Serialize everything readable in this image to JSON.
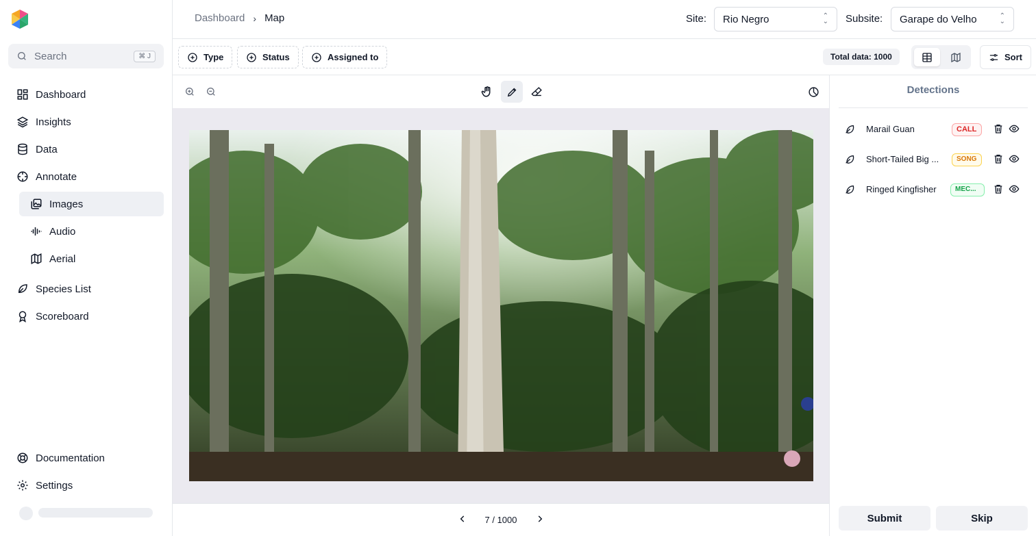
{
  "sidebar": {
    "search": {
      "placeholder": "Search",
      "shortcut": "⌘ J"
    },
    "items": [
      {
        "label": "Dashboard",
        "icon": "dashboard-icon"
      },
      {
        "label": "Insights",
        "icon": "layers-icon"
      },
      {
        "label": "Data",
        "icon": "database-icon"
      },
      {
        "label": "Annotate",
        "icon": "crosshair-icon"
      },
      {
        "label": "Images",
        "icon": "images-icon",
        "active": true
      },
      {
        "label": "Audio",
        "icon": "audio-waveform-icon"
      },
      {
        "label": "Aerial",
        "icon": "map-icon"
      },
      {
        "label": "Species List",
        "icon": "leaf-icon"
      },
      {
        "label": "Scoreboard",
        "icon": "award-icon"
      },
      {
        "label": "Documentation",
        "icon": "lifebuoy-icon"
      },
      {
        "label": "Settings",
        "icon": "gear-icon"
      }
    ]
  },
  "header": {
    "breadcrumb": [
      "Dashboard",
      "Map"
    ],
    "site_label": "Site:",
    "site_value": "Rio Negro",
    "subsite_label": "Subsite:",
    "subsite_value": "Garape do Velho"
  },
  "filters": {
    "buttons": [
      "Type",
      "Status",
      "Assigned to"
    ],
    "total": "Total data: 1000",
    "sort": "Sort",
    "view_selected": "table"
  },
  "pager": {
    "text": "7 / 1000"
  },
  "detections": {
    "title": "Detections",
    "items": [
      {
        "name": "Marail Guan",
        "tag": "CALL"
      },
      {
        "name": "Short-Tailed Big ...",
        "tag": "SONG"
      },
      {
        "name": "Ringed Kingfisher",
        "tag": "MEC..."
      }
    ]
  },
  "actions": {
    "submit": "Submit",
    "skip": "Skip"
  },
  "colors": {
    "accent_bg": "#eef0f4",
    "call": "#dc2626",
    "song": "#d97706",
    "mec": "#16a34a"
  }
}
